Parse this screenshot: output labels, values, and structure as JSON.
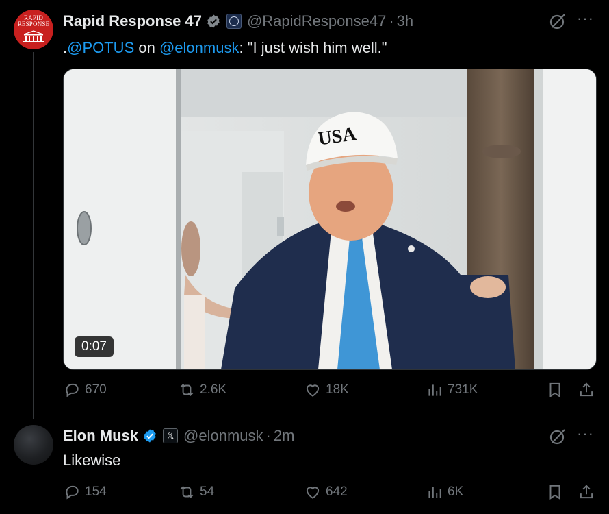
{
  "tweet1": {
    "avatar_text_1": "RAPID",
    "avatar_text_2": "RESPONSE",
    "name": "Rapid Response 47",
    "handle": "@RapidResponse47",
    "separator": "·",
    "time": "3h",
    "text_prefix": ".",
    "mention_1": "@POTUS",
    "text_mid": " on ",
    "mention_2": "@elonmusk",
    "text_suffix": ": \"I just wish him well.\"",
    "video_duration": "0:07",
    "video_hat_text": "USA",
    "counts": {
      "replies": "670",
      "reposts": "2.6K",
      "likes": "18K",
      "views": "731K"
    }
  },
  "tweet2": {
    "name": "Elon Musk",
    "affiliate_badge": "𝕏",
    "handle": "@elonmusk",
    "separator": "·",
    "time": "2m",
    "text": "Likewise",
    "counts": {
      "replies": "154",
      "reposts": "54",
      "likes": "642",
      "views": "6K"
    }
  },
  "more_label": "···",
  "colors": {
    "accent": "#1d9bf0",
    "muted": "#71767b",
    "background": "#000000",
    "text": "#e7e9ea"
  },
  "icons": [
    "reply-icon",
    "repost-icon",
    "like-icon",
    "views-icon",
    "bookmark-icon",
    "share-icon",
    "grok-icon",
    "verified-badge-icon",
    "more-icon"
  ]
}
